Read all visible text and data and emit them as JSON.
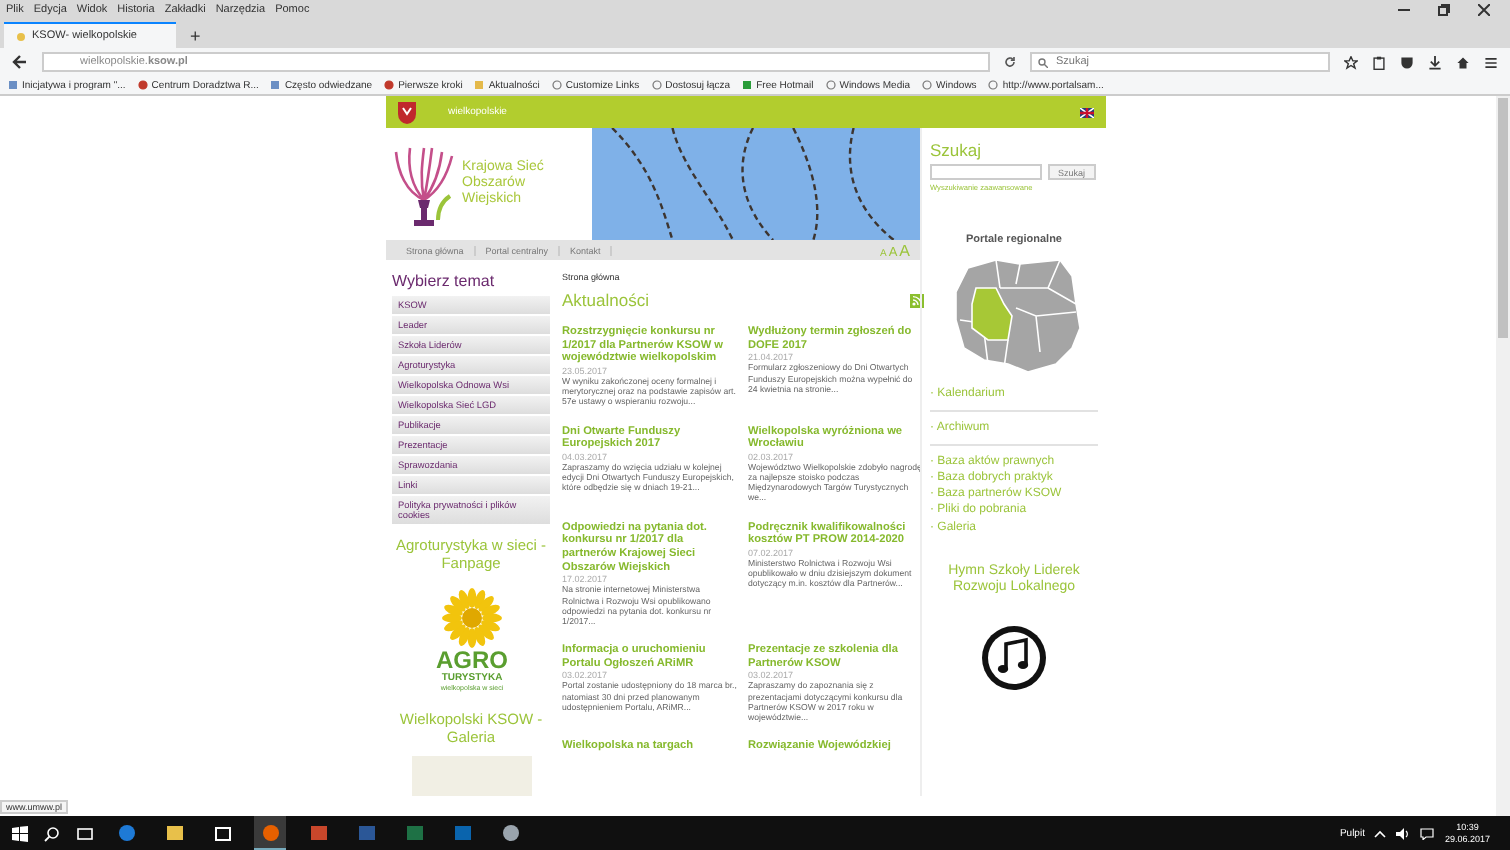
{
  "browser": {
    "menu": [
      "Plik",
      "Edycja",
      "Widok",
      "Historia",
      "Zakładki",
      "Narzędzia",
      "Pomoc"
    ],
    "tabs": [
      {
        "title": "KSOW- wielkopolskie",
        "selected": true
      }
    ],
    "new_tab": "+",
    "url": "wielkopolskie.**ksow.pl**",
    "search": {
      "placeholder": "Szukaj"
    },
    "bookmarks": [
      {
        "label": "Inicjatywa i program \"...",
        "kind": "page"
      },
      {
        "label": "Centrum Doradztwa R...",
        "kind": "app"
      },
      {
        "label": "Często odwiedzane",
        "kind": "page"
      },
      {
        "label": "Pierwsze kroki",
        "kind": "app"
      },
      {
        "label": "Aktualności",
        "kind": "folder"
      },
      {
        "label": "Customize Links",
        "kind": "globe"
      },
      {
        "label": "Dostosuj łącza",
        "kind": "globe"
      },
      {
        "label": "Free Hotmail",
        "kind": "tiles"
      },
      {
        "label": "Windows Media",
        "kind": "globe"
      },
      {
        "label": "Windows",
        "kind": "globe"
      },
      {
        "label": "http://www.portalsam...",
        "kind": "globe"
      }
    ],
    "status_link": "www.umww.pl"
  },
  "site": {
    "region": "wielkopolskie",
    "logo_text": "Krajowa Sieć Obszarów Wiejskich",
    "nav": [
      "Strona główna",
      "Portal centralny",
      "Kontakt"
    ],
    "font_sizes": [
      "A",
      "A",
      "A"
    ],
    "topics_title": "Wybierz temat",
    "topics": [
      "KSOW",
      "Leader",
      "Szkoła Liderów",
      "Agroturystyka",
      "Wielkopolska Odnowa Wsi",
      "Wielkopolska Sieć LGD",
      "Publikacje",
      "Prezentacje",
      "Sprawozdania",
      "Linki",
      "Polityka prywatności i plików cookies"
    ],
    "fanpage_title": "Agroturystyka w sieci - Fanpage",
    "agro_logo": {
      "word": "AGRO",
      "sub": "TURYSTYKA",
      "tagline": "wielkopolska w sieci"
    },
    "gallery_title": "Wielkopolski KSOW - Galeria",
    "breadcrumb": "Strona główna",
    "news_title": "Aktualności",
    "news": [
      {
        "title": "Rozstrzygnięcie konkursu nr 1/2017 dla Partnerów KSOW w województwie wielkopolskim",
        "date": "23.05.2017",
        "text": "W wyniku zakończonej oceny formalnej i merytorycznej oraz na podstawie zapisów art. 57e ustawy o wspieraniu rozwoju..."
      },
      {
        "title": "Wydłużony termin zgłoszeń do DOFE 2017",
        "date": "21.04.2017",
        "text": "Formularz zgłoszeniowy do Dni Otwartych Funduszy Europejskich można wypełnić do 24 kwietnia na stronie..."
      },
      {
        "title": "Dni Otwarte Funduszy Europejskich 2017",
        "date": "04.03.2017",
        "text": "Zapraszamy do wzięcia udziału w kolejnej edycji Dni Otwartych Funduszy Europejskich, które odbędzie się w dniach 19-21..."
      },
      {
        "title": "Wielkopolska wyróżniona we Wrocławiu",
        "date": "02.03.2017",
        "text": "Województwo Wielkopolskie zdobyło nagrodę za najlepsze stoisko podczas Międzynarodowych Targów Turystycznych we..."
      },
      {
        "title": "Odpowiedzi na pytania dot. konkursu nr 1/2017 dla partnerów Krajowej Sieci Obszarów Wiejskich",
        "date": "17.02.2017",
        "text": "Na stronie internetowej Ministerstwa Rolnictwa i Rozwoju Wsi opublikowano odpowiedzi na pytania dot. konkursu nr 1/2017..."
      },
      {
        "title": "Podręcznik kwalifikowalności kosztów PT PROW 2014-2020",
        "date": "07.02.2017",
        "text": "Ministerstwo Rolnictwa i Rozwoju Wsi opublikowało w dniu dzisiejszym dokument dotyczący m.in. kosztów dla Partnerów..."
      },
      {
        "title": "Informacja o uruchomieniu Portalu Ogłoszeń ARiMR",
        "date": "03.02.2017",
        "text": "Portal zostanie udostępniony do 18 marca br., natomiast 30 dni przed planowanym udostępnieniem Portalu, ARiMR..."
      },
      {
        "title": "Prezentacje ze szkolenia dla Partnerów KSOW",
        "date": "03.02.2017",
        "text": "Zapraszamy do zapoznania się z prezentacjami dotyczącymi konkursu dla Partnerów KSOW w 2017 roku w województwie..."
      },
      {
        "title": "Wielkopolska na targach"
      },
      {
        "title": "Rozwiązanie Wojewódzkiej"
      }
    ],
    "search_title": "Szukaj",
    "search_button": "Szukaj",
    "advanced_search": "Wyszukiwanie zaawansowane",
    "regional_title": "Portale regionalne",
    "side_links": [
      {
        "label": "· Kalendarium",
        "kind": "section"
      },
      {
        "label": "· Archiwum",
        "kind": "section"
      },
      {
        "label": "· Baza aktów prawnych",
        "kind": "list"
      },
      {
        "label": "· Baza dobrych praktyk",
        "kind": "list"
      },
      {
        "label": "· Baza partnerów KSOW",
        "kind": "list"
      },
      {
        "label": "· Pliki do pobrania",
        "kind": "list"
      },
      {
        "label": "· Galeria",
        "kind": "list"
      }
    ],
    "hymn_title": "Hymn Szkoły Liderek Rozwoju Lokalnego"
  },
  "taskbar": {
    "apps": [
      {
        "kind": "edge",
        "active": false
      },
      {
        "kind": "explorer",
        "active": false
      },
      {
        "kind": "store",
        "active": false
      },
      {
        "kind": "firefox",
        "active": true
      },
      {
        "kind": "powerpoint",
        "active": false
      },
      {
        "kind": "word",
        "active": false
      },
      {
        "kind": "excel",
        "active": false
      },
      {
        "kind": "outlook",
        "active": false
      },
      {
        "kind": "tool",
        "active": false
      }
    ],
    "desktop_label": "Pulpit",
    "time": "10:39",
    "date": "29.06.2017"
  }
}
